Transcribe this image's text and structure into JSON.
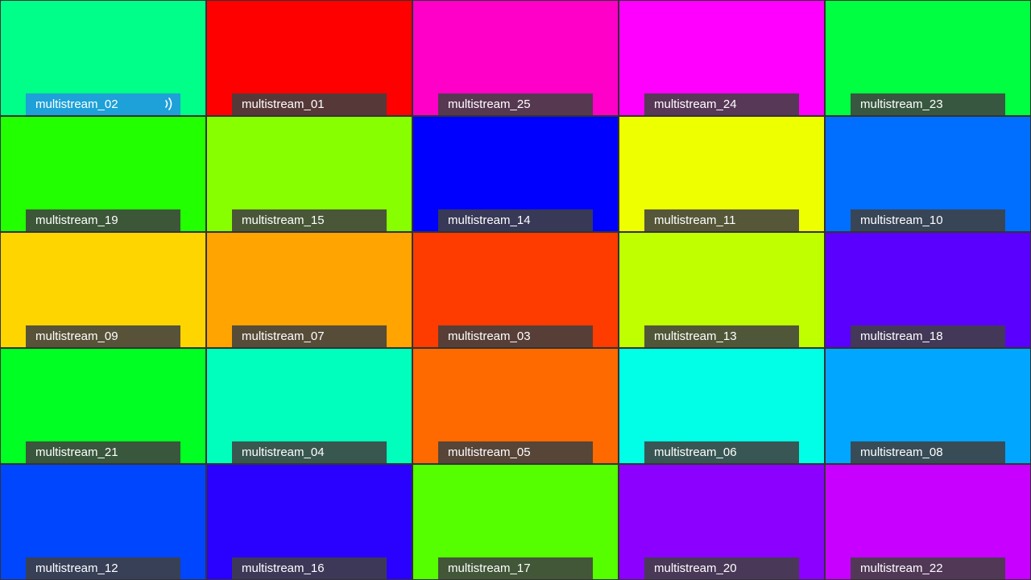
{
  "tiles": [
    {
      "name": "multistream_02",
      "color": "#00ff88",
      "active": true,
      "icon": "audio-speaking-icon"
    },
    {
      "name": "multistream_01",
      "color": "#ff0000"
    },
    {
      "name": "multistream_25",
      "color": "#ff00c8"
    },
    {
      "name": "multistream_24",
      "color": "#ff00ff"
    },
    {
      "name": "multistream_23",
      "color": "#00ff40"
    },
    {
      "name": "multistream_19",
      "color": "#22ff00"
    },
    {
      "name": "multistream_15",
      "color": "#88ff00"
    },
    {
      "name": "multistream_14",
      "color": "#0000ff"
    },
    {
      "name": "multistream_11",
      "color": "#eeff00"
    },
    {
      "name": "multistream_10",
      "color": "#006eff"
    },
    {
      "name": "multistream_09",
      "color": "#ffd500"
    },
    {
      "name": "multistream_07",
      "color": "#ffa400"
    },
    {
      "name": "multistream_03",
      "color": "#ff3c00"
    },
    {
      "name": "multistream_13",
      "color": "#c0ff00"
    },
    {
      "name": "multistream_18",
      "color": "#5a00ff"
    },
    {
      "name": "multistream_21",
      "color": "#00ff22"
    },
    {
      "name": "multistream_04",
      "color": "#00ffbc"
    },
    {
      "name": "multistream_05",
      "color": "#ff6a00"
    },
    {
      "name": "multistream_06",
      "color": "#00ffe6"
    },
    {
      "name": "multistream_08",
      "color": "#00a6ff"
    },
    {
      "name": "multistream_12",
      "color": "#0046ff"
    },
    {
      "name": "multistream_16",
      "color": "#2a00ff"
    },
    {
      "name": "multistream_17",
      "color": "#55ff00"
    },
    {
      "name": "multistream_20",
      "color": "#8c00ff"
    },
    {
      "name": "multistream_22",
      "color": "#c800ff"
    }
  ]
}
